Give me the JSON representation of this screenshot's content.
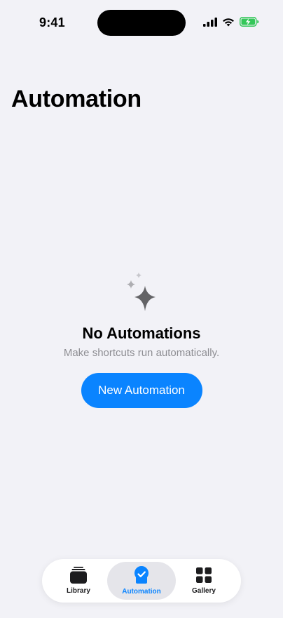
{
  "status_bar": {
    "time": "9:41",
    "icons": [
      "cellular-signal-icon",
      "wifi-icon",
      "battery-charging-icon"
    ],
    "battery_color": "#34c759"
  },
  "header": {
    "title": "Automation"
  },
  "empty_state": {
    "icon": "sparkles-icon",
    "title": "No Automations",
    "subtitle": "Make shortcuts run automatically.",
    "button_label": "New Automation"
  },
  "tab_bar": {
    "selected": "Automation",
    "tabs": [
      {
        "label": "Library",
        "icon": "library-stack-icon"
      },
      {
        "label": "Automation",
        "icon": "automation-check-icon"
      },
      {
        "label": "Gallery",
        "icon": "gallery-grid-icon"
      }
    ]
  },
  "colors": {
    "accent": "#0a84ff",
    "background": "#f2f2f7",
    "secondary_text": "#8e8e93"
  }
}
